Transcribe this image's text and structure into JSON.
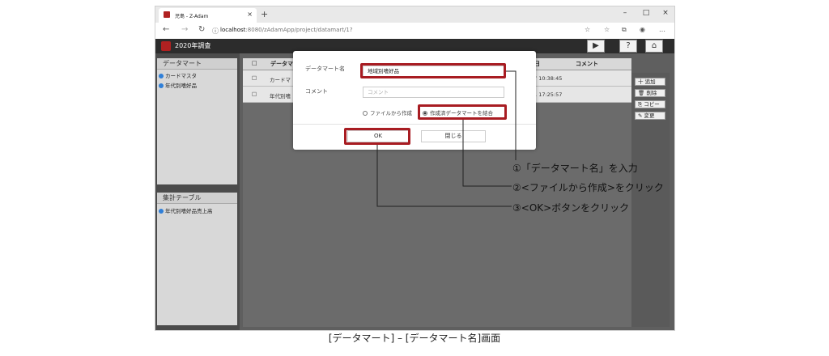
{
  "browser": {
    "tab_title": "児島 - Z-Adam",
    "tab_close": "×",
    "new_tab": "+",
    "url_host": "localhost",
    "url_rest": ":8080/zAdamApp/project/datamart/1?",
    "window_buttons": [
      "–",
      "□",
      "×"
    ],
    "nav_icons": [
      "←",
      "→",
      "↻",
      "ⓘ"
    ],
    "toolbar_icons": [
      "☆",
      "☆",
      "⧉",
      "◉",
      "…"
    ]
  },
  "app": {
    "title": "2020年調査",
    "header_buttons": [
      "▶",
      "?",
      "⌂"
    ]
  },
  "left": {
    "datamart_header": "データマート",
    "datamart_items": [
      "カードマスタ",
      "年代別嗜好品"
    ],
    "table_header": "集計テーブル",
    "table_items": [
      "年代別嗜好品売上高"
    ]
  },
  "grid": {
    "header_check": "□",
    "header_name": "データマ",
    "header_date": "日",
    "header_comment": "コメント",
    "rows": [
      {
        "check": "□",
        "name": "カードマ",
        "date": "7 10:38:45"
      },
      {
        "check": "□",
        "name": "年代別嗜",
        "date": "1 17:25:57"
      }
    ]
  },
  "actions": [
    "十 追加",
    "🗑 削除",
    "⎘ コピー",
    "✎ 変更"
  ],
  "modal": {
    "name_label": "データマート名",
    "name_value": "地域別嗜好品",
    "comment_label": "コメント",
    "comment_placeholder": "コメント",
    "radio_file": "ファイルから作成",
    "radio_combine": "作成済データマートを結合",
    "ok_label": "OK",
    "close_label": "閉じる"
  },
  "callouts": {
    "c1": "①「データマート名」を入力",
    "c2": "②<ファイルから作成>をクリック",
    "c3": "③<OK>ボタンをクリック"
  },
  "colors": {
    "highlight": "#a81c22",
    "brand": "#b02121",
    "check": "#2f7fd8"
  },
  "caption": "[データマート] – [データマート名]画面"
}
